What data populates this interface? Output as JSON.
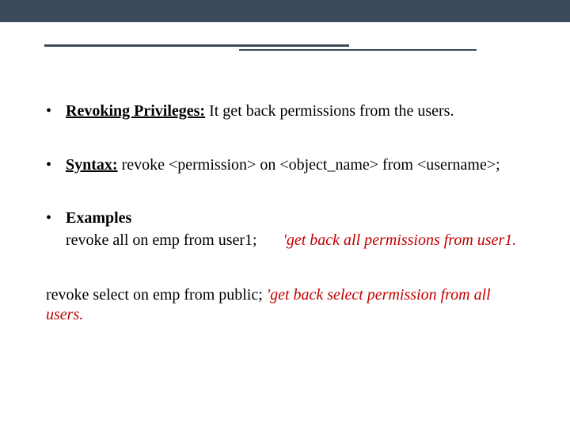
{
  "bullets": [
    {
      "label": "Revoking Privileges:",
      "text": " It get back permissions from the users."
    },
    {
      "label": "Syntax:",
      "text": "      revoke <permission> on <object_name> from <username>;"
    }
  ],
  "examples": {
    "heading": "Examples",
    "line1_cmd": "revoke all on emp from user1;",
    "line1_note": "'get back all permissions from user1."
  },
  "footnote": {
    "cmd": "revoke select on emp from public;",
    "note_lead": "'get back select permission from all",
    "note_tail": "users."
  }
}
